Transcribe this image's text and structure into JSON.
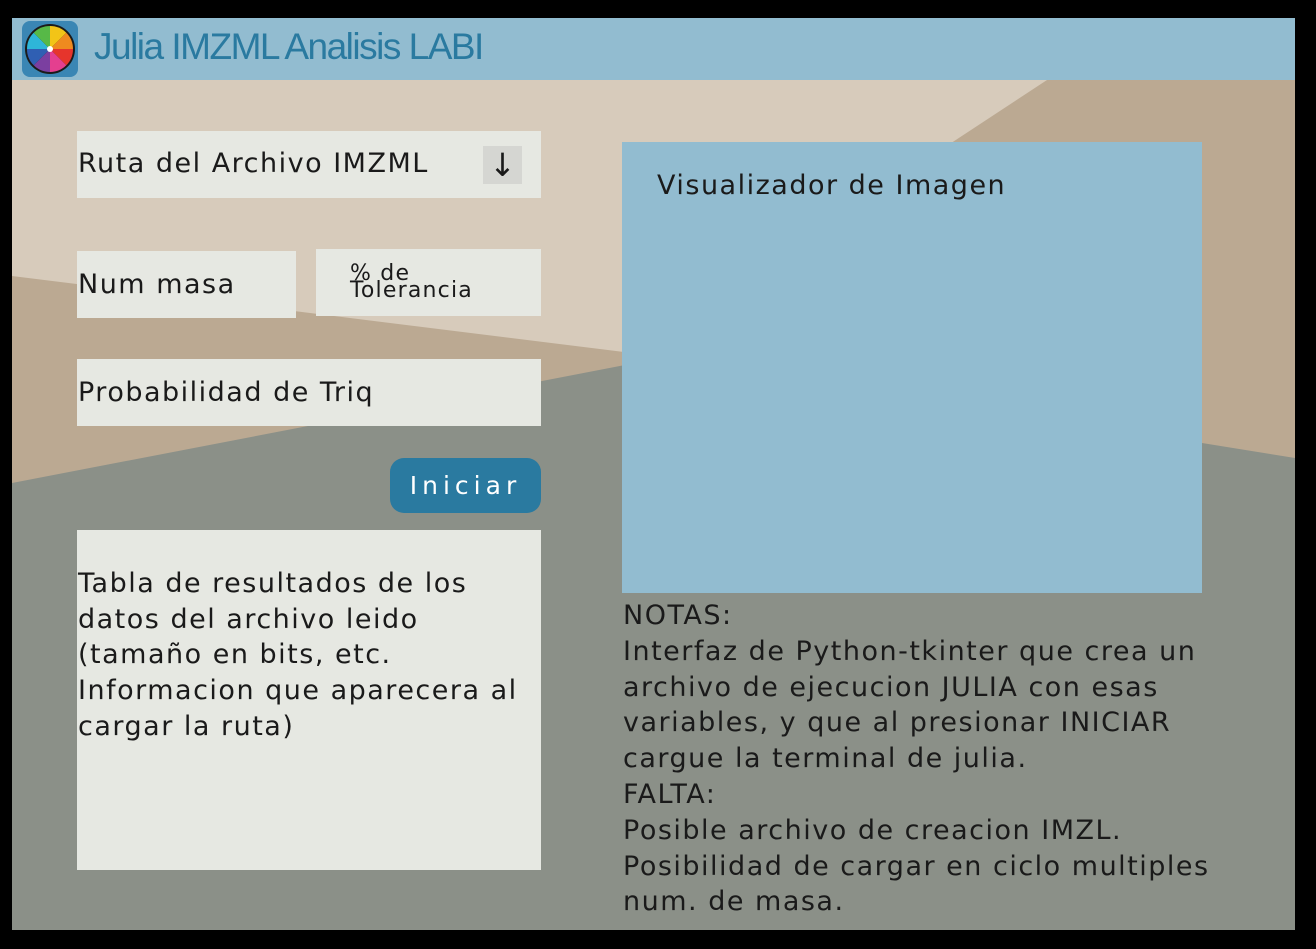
{
  "app": {
    "title": "Julia IMZML Analisis LABI",
    "logo_icon": "color-wheel-icon"
  },
  "colors": {
    "titlebar": "#92bcd0",
    "accent": "#2a7aa0",
    "field_bg": "#e6e8e2",
    "viewer_bg": "#92bcd0",
    "bg_dark": "#8b9088",
    "bg_light": "#d7cbbb",
    "bg_mid": "#bba992"
  },
  "form": {
    "ruta": {
      "placeholder": "Ruta del Archivo IMZML",
      "dropdown_glyph": "↓",
      "dropdown_icon": "arrow-down-icon"
    },
    "num_masa": {
      "placeholder": "Num masa"
    },
    "tolerancia": {
      "placeholder": "% de Tolerancia"
    },
    "probabilidad": {
      "placeholder": "Probabilidad de Triq"
    },
    "iniciar_label": "Iniciar"
  },
  "results": {
    "text": "Tabla de resultados de los datos del archivo leido (tamaño en bits, etc. Informacion que aparecera al cargar la ruta)"
  },
  "viewer": {
    "label": "Visualizador de Imagen"
  },
  "notes": {
    "text": "NOTAS:\nInterfaz de Python-tkinter que crea un archivo de ejecucion JULIA con esas variables, y que al presionar INICIAR cargue la terminal de julia.\nFALTA:\nPosible archivo de creacion IMZL.\nPosibilidad de cargar en ciclo multiples num. de masa."
  }
}
